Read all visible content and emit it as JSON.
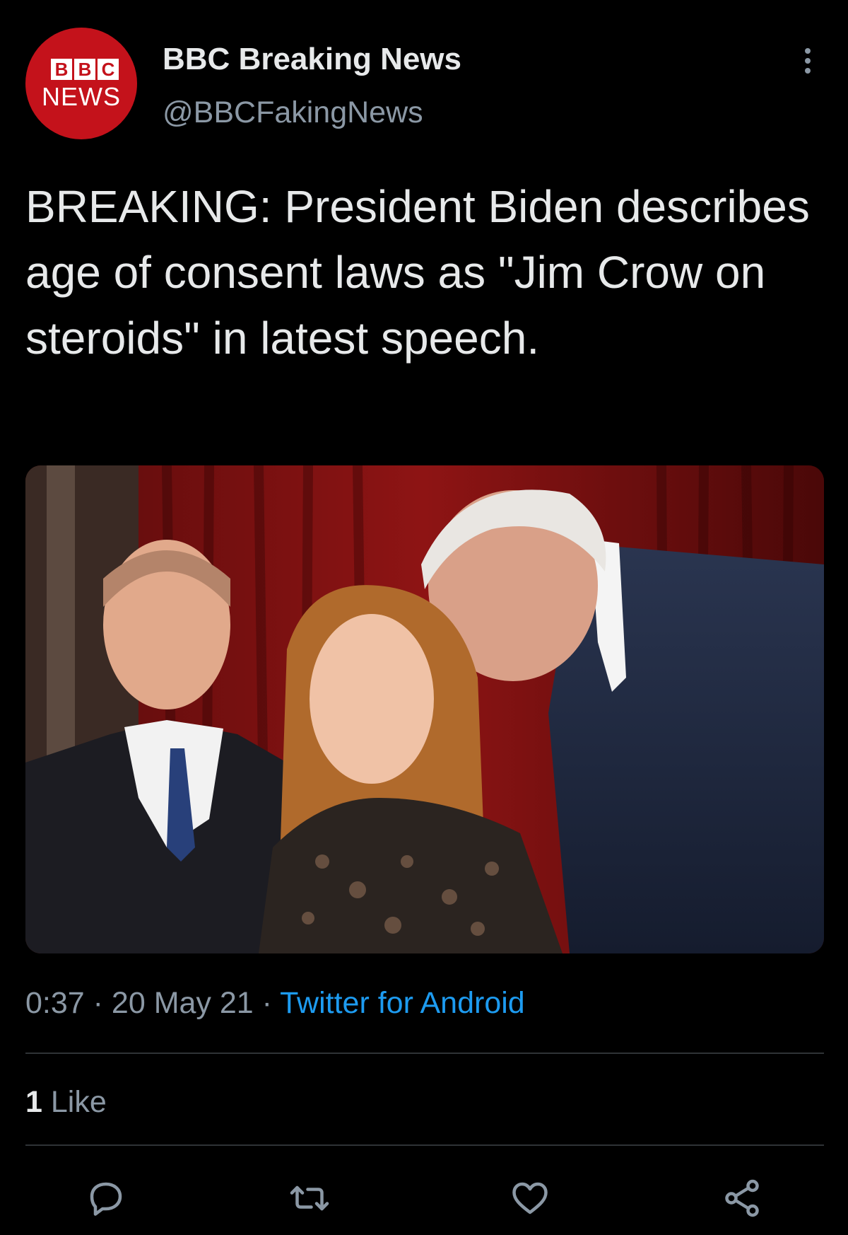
{
  "author": {
    "avatar_blocks": [
      "B",
      "B",
      "C"
    ],
    "avatar_subtext": "NEWS",
    "display_name": "BBC Breaking News",
    "handle": "@BBCFakingNews",
    "avatar_color": "#c4121b"
  },
  "tweet": {
    "text": "BREAKING: President Biden describes age of consent laws as \"Jim Crow on steroids\" in latest speech.",
    "time": "0:37",
    "separator": " · ",
    "date": "20 May 21",
    "source": "Twitter for Android"
  },
  "engagement": {
    "like_count": "1",
    "like_label": "Like"
  },
  "icons": {
    "more": "more-vertical-icon",
    "reply": "reply-icon",
    "retweet": "retweet-icon",
    "like": "heart-icon",
    "share": "share-icon"
  },
  "colors": {
    "background": "#000000",
    "text": "#e7e9ea",
    "secondary": "#8b98a5",
    "link": "#1d9bf0",
    "divider": "#2f3336"
  }
}
